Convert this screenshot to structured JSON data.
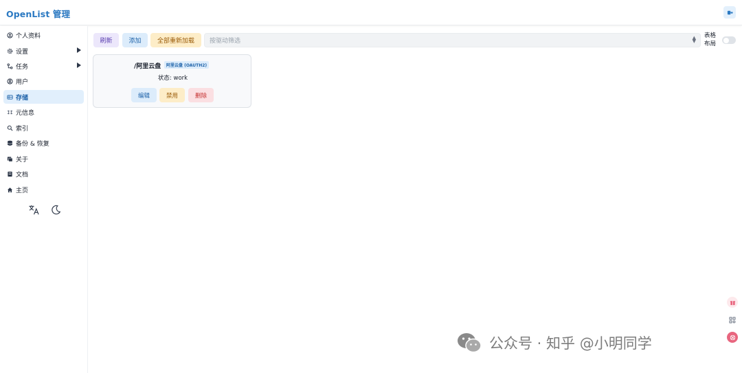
{
  "header": {
    "brand": "OpenList 管理",
    "logout_icon": "logout-icon"
  },
  "sidebar": {
    "items": [
      {
        "label": "个人资料",
        "icon": "user-circle-icon"
      },
      {
        "label": "设置",
        "icon": "gear-icon"
      },
      {
        "label": "任务",
        "icon": "task-icon"
      },
      {
        "label": "用户",
        "icon": "user-icon"
      },
      {
        "label": "存储",
        "icon": "storage-icon"
      },
      {
        "label": "元信息",
        "icon": "meta-icon"
      },
      {
        "label": "索引",
        "icon": "search-icon"
      },
      {
        "label": "备份 & 恢复",
        "icon": "database-icon"
      },
      {
        "label": "关于",
        "icon": "about-icon"
      },
      {
        "label": "文档",
        "icon": "book-icon"
      },
      {
        "label": "主页",
        "icon": "home-icon"
      }
    ],
    "active": "存储",
    "tools": [
      "translate-icon",
      "moon-icon"
    ]
  },
  "toolbar": {
    "refresh": "刷新",
    "add": "添加",
    "reload_all": "全部重新加载",
    "filter_placeholder": "按驱动筛选",
    "table_layout_label": "表格布局",
    "table_layout_on": false
  },
  "storages": [
    {
      "mount_path": "/阿里云盘",
      "driver": "阿里云盘 (OAUTH2)",
      "status": "状态: work",
      "edit": "编辑",
      "disable": "禁用",
      "delete": "删除"
    }
  ],
  "watermark": "公众号 · 知乎 @小明同学",
  "colors": {
    "accent": "#2b79c2",
    "active_bg": "#e1effc",
    "warning_bg": "#fdedc8",
    "danger_bg": "#fbdfe2",
    "purple_bg": "#ece7fb"
  }
}
